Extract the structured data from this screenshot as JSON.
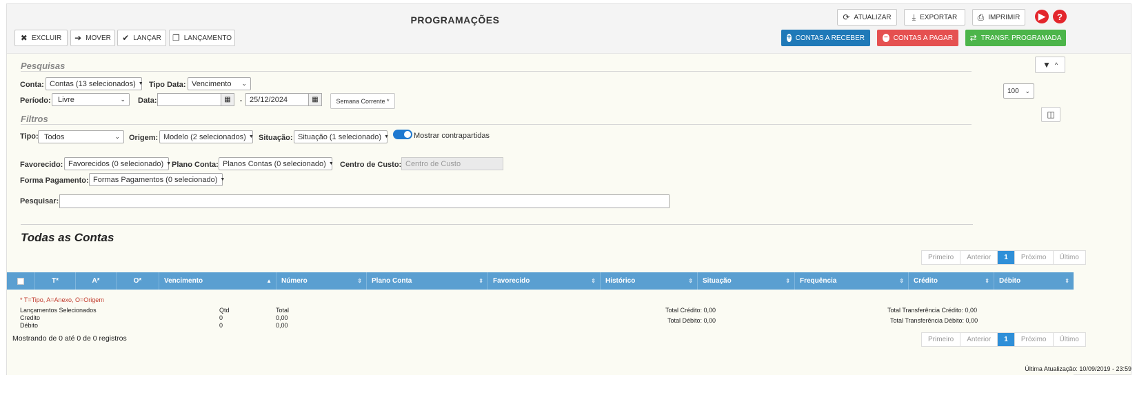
{
  "header": {
    "title": "PROGRAMAÇÕES",
    "buttons": {
      "excluir": "EXCLUIR",
      "mover": "MOVER",
      "lancar": "LANÇAR",
      "lancamento": "LANÇAMENTO",
      "atualizar": "ATUALIZAR",
      "exportar": "EXPORTAR",
      "imprimir": "IMPRIMIR",
      "contas_receber": "CONTAS A RECEBER",
      "contas_pagar": "CONTAS A PAGAR",
      "transf": "TRANSF. PROGRAMADA"
    },
    "help": "?"
  },
  "pesquisas": {
    "title": "Pesquisas",
    "conta_label": "Conta:",
    "conta_value": "Contas (13 selecionados)",
    "tipo_data_label": "Tipo Data:",
    "tipo_data_value": "Vencimento",
    "periodo_label": "Período:",
    "periodo_value": "Livre",
    "data_label": "Data:",
    "data_start": "",
    "data_sep": "-",
    "data_end": "25/12/2024",
    "semana_button": "Semana Corrente *",
    "page_size": "100"
  },
  "filtros": {
    "title": "Filtros",
    "tipo_label": "Tipo:",
    "tipo_value": "Todos",
    "origem_label": "Origem:",
    "origem_value": "Modelo (2 selecionados)",
    "situacao_label": "Situação:",
    "situacao_value": "Situação (1 selecionado)",
    "contrapartidas_label": "Mostrar contrapartidas",
    "favorecido_label": "Favorecido:",
    "favorecido_value": "Favorecidos (0 selecionado)",
    "plano_label": "Plano Conta:",
    "plano_value": "Planos Contas (0 selecionado)",
    "centro_label": "Centro de Custo:",
    "centro_placeholder": "Centro de Custo",
    "forma_label": "Forma Pagamento:",
    "forma_value": "Formas Pagamentos (0 selecionado)",
    "pesquisar_label": "Pesquisar:",
    "pesquisar_value": ""
  },
  "table": {
    "title": "Todas as Contas",
    "pager": [
      "Primeiro",
      "Anterior",
      "1",
      "Próximo",
      "Último"
    ],
    "columns": [
      "T*",
      "A*",
      "O*",
      "Vencimento",
      "Número",
      "Plano Conta",
      "Favorecido",
      "Histórico",
      "Situação",
      "Frequência",
      "Crédito",
      "Débito"
    ],
    "legend": "* T=Tipo, A=Anexo, O=Origem"
  },
  "summary": {
    "label": "Lançamentos Selecionados",
    "qtd_header": "Qtd",
    "total_header": "Total",
    "credito_label": "Credito",
    "credito_qtd": "0",
    "credito_total": "0,00",
    "debito_label": "Débito",
    "debito_qtd": "0",
    "debito_total": "0,00",
    "total_credito": "Total Crédito: 0,00",
    "total_debito": "Total Débito: 0,00",
    "total_transf_credito": "Total Transferência Crédito: 0,00",
    "total_transf_debito": "Total Transferência Débito: 0,00",
    "mostrando": "Mostrando de 0 até 0 de 0 registros"
  },
  "footer": {
    "ultima_atualizacao": "Última Atualização: 10/09/2019 - 23:59"
  }
}
